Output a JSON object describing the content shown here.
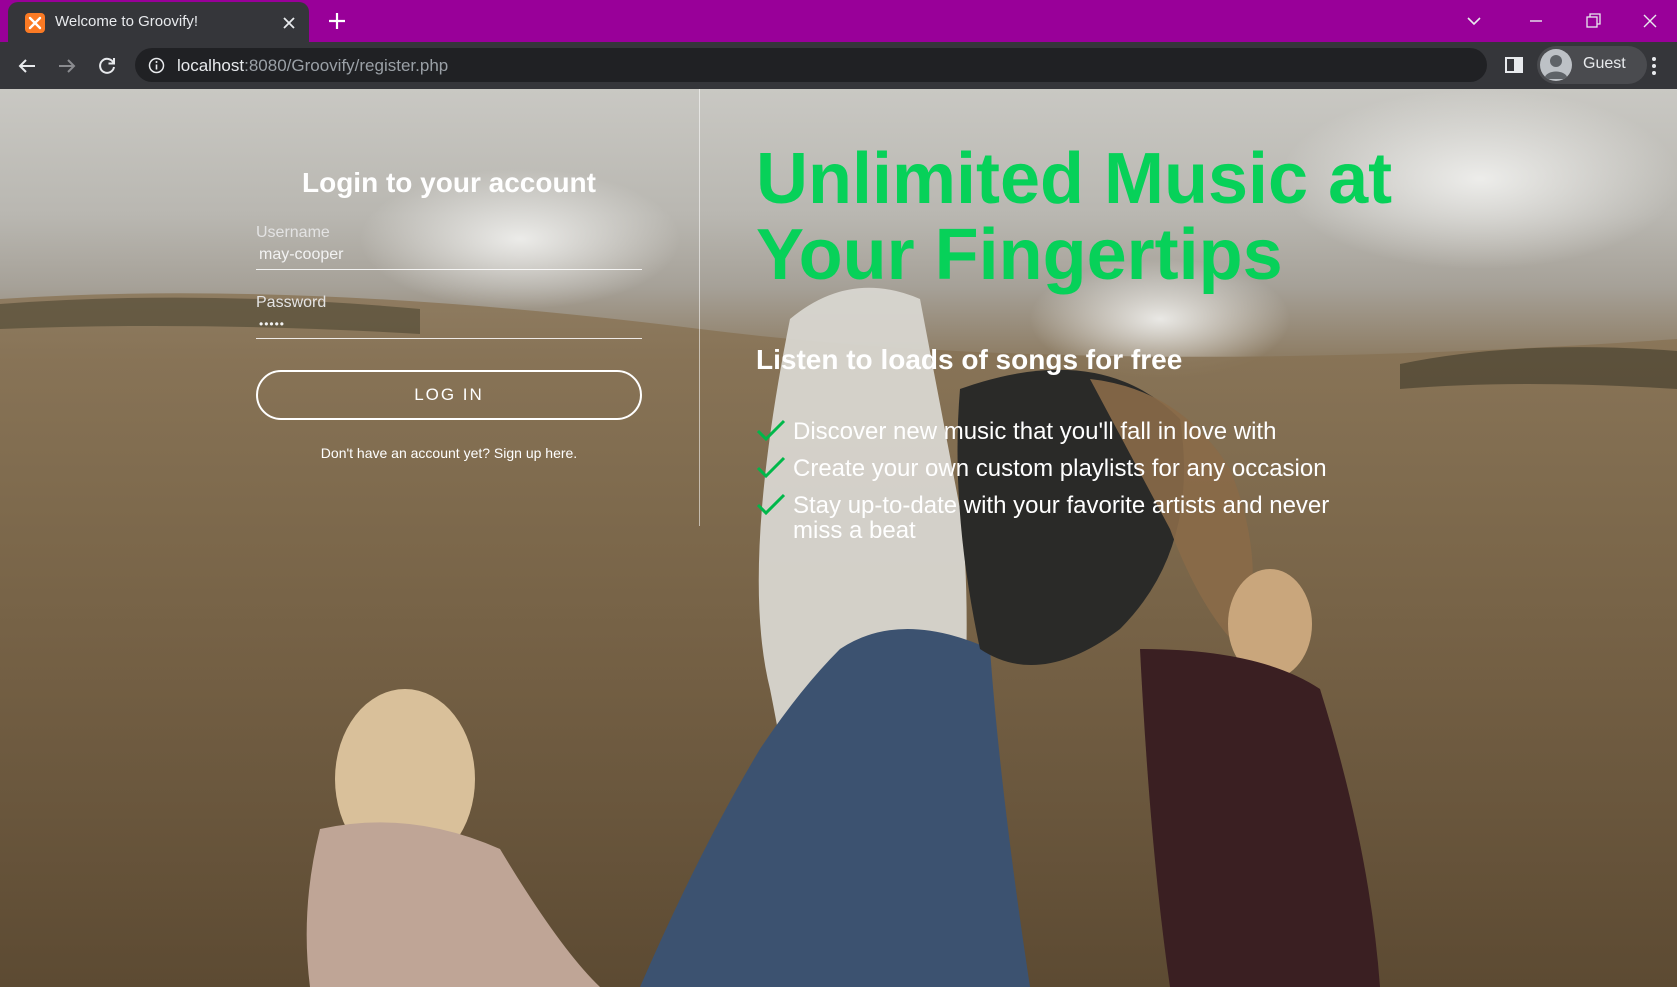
{
  "browser": {
    "tab_title": "Welcome to Groovify!",
    "url_host": "localhost",
    "url_rest": ":8080/Groovify/register.php",
    "profile_label": "Guest",
    "accent_color": "#990099"
  },
  "login": {
    "title": "Login to your account",
    "username_label": "Username",
    "username_value": "may-cooper",
    "password_label": "Password",
    "password_value": "•••••",
    "login_button": "LOG IN",
    "signup_text": "Don't have an account yet? Sign up here."
  },
  "hero": {
    "title": "Unlimited Music at Your Fingertips",
    "subtitle": "Listen to loads of songs for free",
    "features": [
      "Discover new music that you'll fall in love with",
      "Create your own custom playlists for any occasion",
      "Stay up-to-date with your favorite artists and never miss a beat"
    ]
  },
  "colors": {
    "brand_green": "#07d159",
    "check_color": "#00b84a"
  },
  "icons": {
    "back": "arrow-left-icon",
    "forward": "arrow-right-icon",
    "reload": "reload-icon",
    "info": "info-icon",
    "check": "check-icon"
  }
}
